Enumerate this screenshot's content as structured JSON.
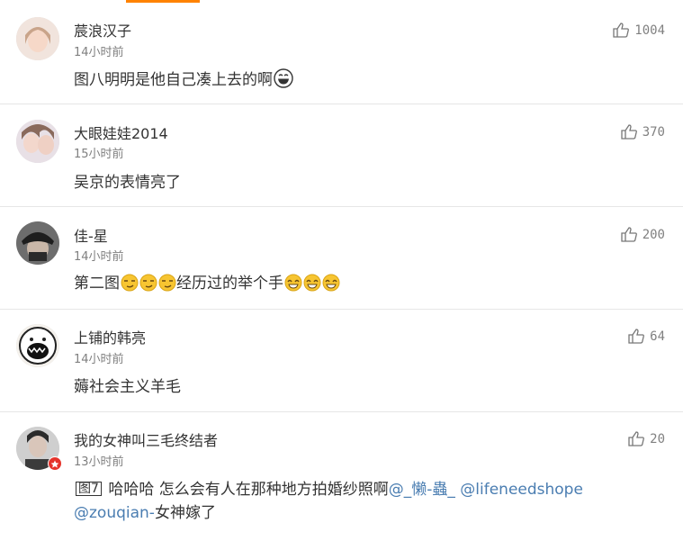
{
  "colors": {
    "accent": "#ff8200",
    "mention": "#4a7db1",
    "verified_badge": "#e5342c"
  },
  "comments": [
    {
      "name": "莀浪汉子",
      "time": "14小时前",
      "text": "图八明明是他自己凑上去的啊",
      "likes": "1004",
      "emoji": "grin"
    },
    {
      "name": "大眼娃娃2014",
      "time": "15小时前",
      "text": "吴京的表情亮了",
      "likes": "370"
    },
    {
      "name": "佳-星",
      "time": "14小时前",
      "text_prefix": "第二图",
      "text_mid": "经历过的举个手",
      "likes": "200"
    },
    {
      "name": "上铺的韩亮",
      "time": "14小时前",
      "text": "薅社会主义羊毛",
      "likes": "64"
    },
    {
      "name": "我的女神叫三毛终结者",
      "time": "13小时前",
      "pic_tag": "图7",
      "text": "哈哈哈 怎么会有人在那种地方拍婚纱照啊",
      "mention1": "@_懒-蟲_",
      "mention2": "@lifeneedshope",
      "mention3": "@zouqian-",
      "text_tail": "女神嫁了",
      "likes": "20"
    }
  ]
}
